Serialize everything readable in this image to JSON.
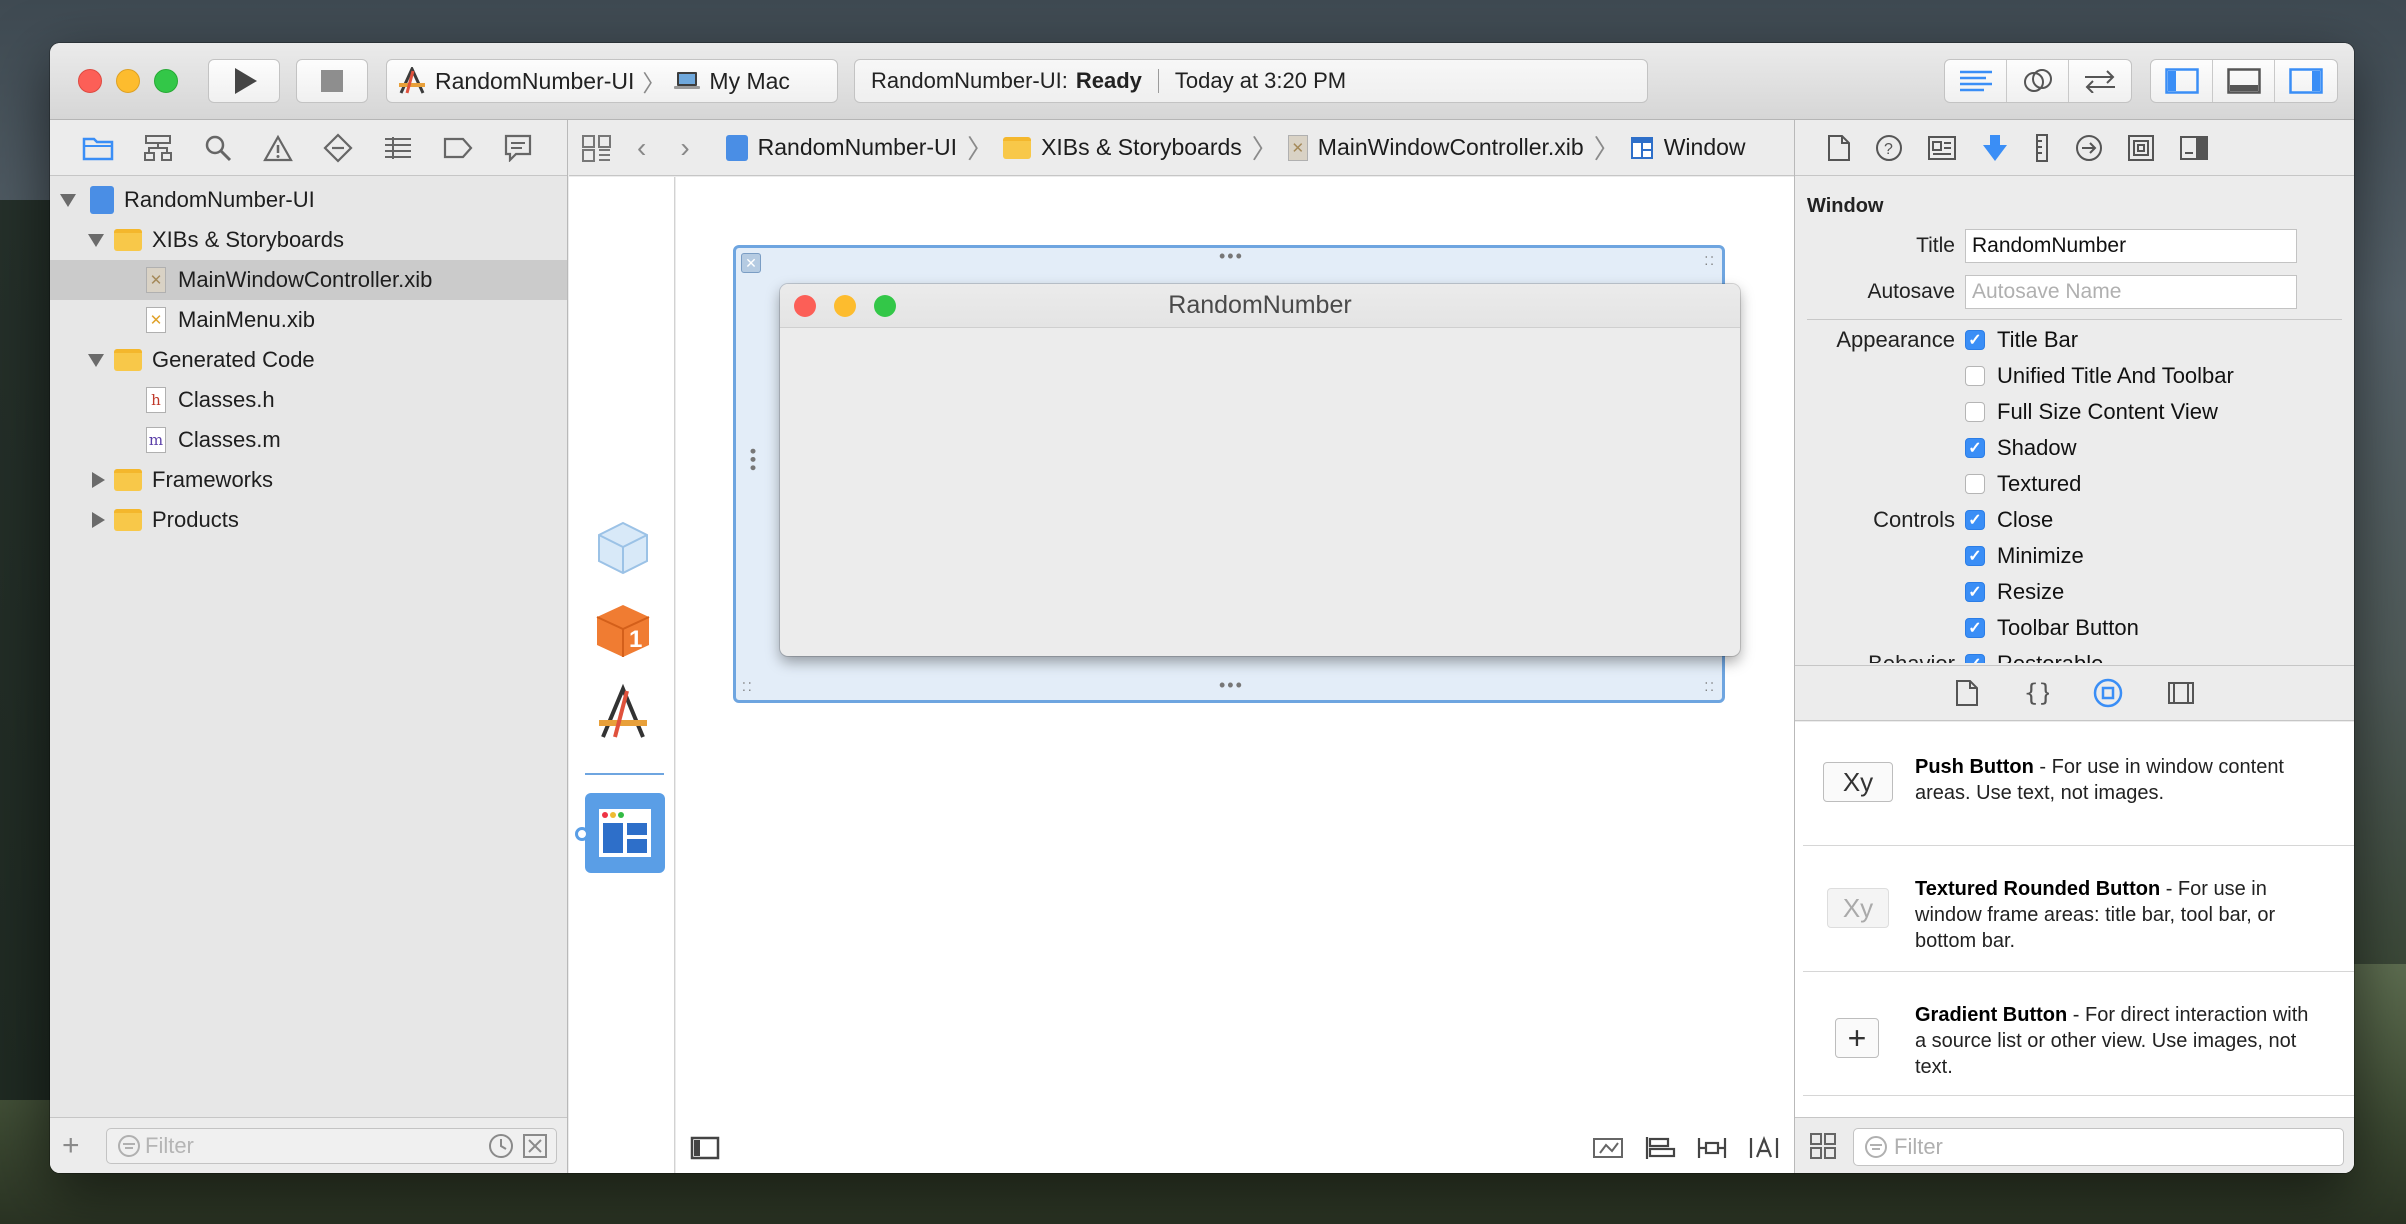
{
  "toolbar": {
    "scheme_name": "RandomNumber-UI",
    "destination": "My Mac",
    "activity_project": "RandomNumber-UI:",
    "activity_status": "Ready",
    "activity_time": "Today at 3:20 PM"
  },
  "navigator": {
    "tree": [
      {
        "label": "RandomNumber-UI"
      },
      {
        "label": "XIBs & Storyboards"
      },
      {
        "label": "MainWindowController.xib"
      },
      {
        "label": "MainMenu.xib"
      },
      {
        "label": "Generated Code"
      },
      {
        "label": "Classes.h"
      },
      {
        "label": "Classes.m"
      },
      {
        "label": "Frameworks"
      },
      {
        "label": "Products"
      }
    ],
    "filter_placeholder": "Filter"
  },
  "jumpbar": {
    "crumbs": [
      "RandomNumber-UI",
      "XIBs & Storyboards",
      "MainWindowController.xib",
      "Window"
    ]
  },
  "canvas": {
    "window_title": "RandomNumber"
  },
  "inspector": {
    "section": "Window",
    "title_label": "Title",
    "title_value": "RandomNumber",
    "autosave_label": "Autosave",
    "autosave_placeholder": "Autosave Name",
    "appearance_label": "Appearance",
    "controls_label": "Controls",
    "behavior_label": "Behavior",
    "checks": [
      {
        "label": "Title Bar",
        "checked": true
      },
      {
        "label": "Unified Title And Toolbar",
        "checked": false
      },
      {
        "label": "Full Size Content View",
        "checked": false
      },
      {
        "label": "Shadow",
        "checked": true
      },
      {
        "label": "Textured",
        "checked": false
      },
      {
        "label": "Close",
        "checked": true
      },
      {
        "label": "Minimize",
        "checked": true
      },
      {
        "label": "Resize",
        "checked": true
      },
      {
        "label": "Toolbar Button",
        "checked": true
      },
      {
        "label": "Restorable",
        "checked": true
      }
    ]
  },
  "library": {
    "items": [
      {
        "icon_text": "Xy",
        "name": "Push Button",
        "desc": " - For use in window content areas. Use text, not images."
      },
      {
        "icon_text": "Xy",
        "name": "Textured Rounded Button",
        "desc": " - For use in window frame areas: title bar, tool bar, or bottom bar."
      },
      {
        "icon_text": "+",
        "name": "Gradient Button",
        "desc": " - For direct interaction with a source list or other view. Use images, not text."
      }
    ],
    "filter_placeholder": "Filter"
  },
  "colors": {
    "accent": "#3a8ef6",
    "selection_frame": "#6ea5e0"
  }
}
